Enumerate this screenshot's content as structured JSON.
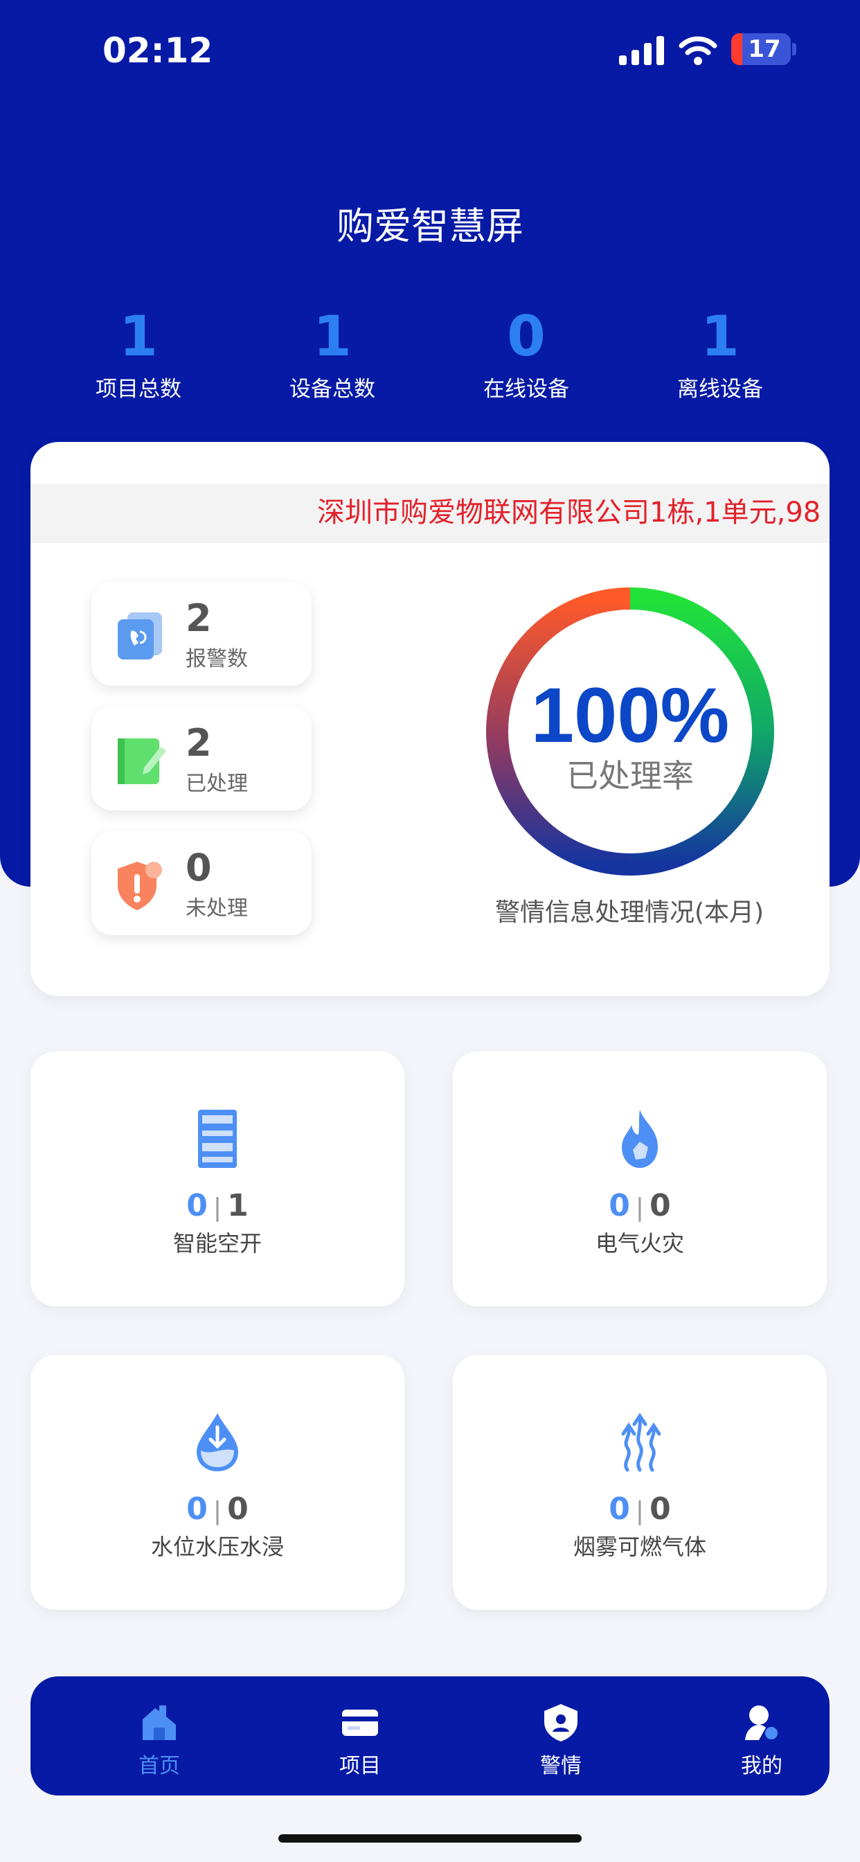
{
  "status_bar": {
    "time": "02:12",
    "battery": "17"
  },
  "app": {
    "title": "购爱智慧屏"
  },
  "stats": [
    {
      "value": "1",
      "label": "项目总数"
    },
    {
      "value": "1",
      "label": "设备总数"
    },
    {
      "value": "0",
      "label": "在线设备"
    },
    {
      "value": "1",
      "label": "离线设备"
    }
  ],
  "alarm": {
    "marquee": "深圳市购爱物联网有限公司1栋,1单元,98",
    "items": [
      {
        "value": "2",
        "label": "报警数"
      },
      {
        "value": "2",
        "label": "已处理"
      },
      {
        "value": "0",
        "label": "未处理"
      }
    ],
    "rate": {
      "percent": "100%",
      "label": "已处理率",
      "fraction": 1.0
    },
    "caption": "警情信息处理情况(本月)"
  },
  "devices": [
    {
      "online": "0",
      "sep": "|",
      "total": "1",
      "label": "智能空开"
    },
    {
      "online": "0",
      "sep": "|",
      "total": "0",
      "label": "电气火灾"
    },
    {
      "online": "0",
      "sep": "|",
      "total": "0",
      "label": "水位水压水浸"
    },
    {
      "online": "0",
      "sep": "|",
      "total": "0",
      "label": "烟雾可燃气体"
    }
  ],
  "tabs": [
    {
      "label": "首页",
      "active": true
    },
    {
      "label": "项目",
      "active": false
    },
    {
      "label": "警情",
      "active": false
    },
    {
      "label": "我的",
      "active": false
    }
  ],
  "colors": {
    "brand": "#071aa5",
    "accent": "#2c7ff2",
    "alert": "#e3212b"
  }
}
